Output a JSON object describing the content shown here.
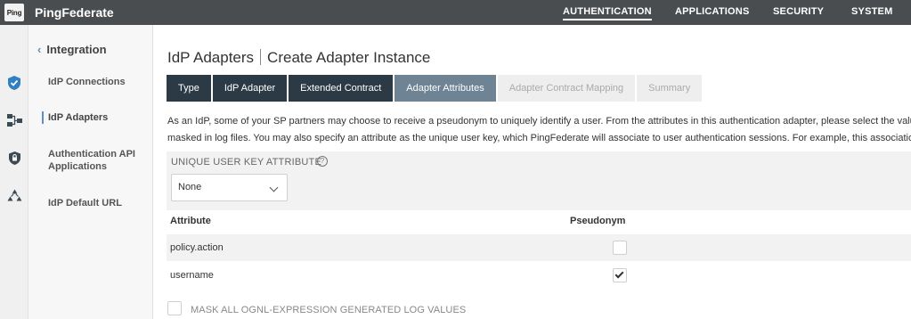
{
  "app": {
    "logo_text": "Ping",
    "brand": "PingFederate"
  },
  "topnav": [
    {
      "label": "AUTHENTICATION",
      "active": true
    },
    {
      "label": "APPLICATIONS",
      "active": false
    },
    {
      "label": "SECURITY",
      "active": false
    },
    {
      "label": "SYSTEM",
      "active": false
    }
  ],
  "rail_icons": [
    "shield-check-icon",
    "network-icon",
    "shield-lock-icon",
    "nodes-icon"
  ],
  "subnav": {
    "back_label": "Integration",
    "items": [
      {
        "label": "IdP Connections",
        "active": false
      },
      {
        "label": "IdP Adapters",
        "active": true
      },
      {
        "label": "Authentication API Applications",
        "active": false
      },
      {
        "label": "IdP Default URL",
        "active": false
      }
    ]
  },
  "page": {
    "title_section": "IdP Adapters",
    "title_page": "Create Adapter Instance",
    "steps": [
      {
        "label": "Type",
        "state": "done"
      },
      {
        "label": "IdP Adapter",
        "state": "done"
      },
      {
        "label": "Extended Contract",
        "state": "done"
      },
      {
        "label": "Adapter Attributes",
        "state": "current"
      },
      {
        "label": "Adapter Contract Mapping",
        "state": "todo"
      },
      {
        "label": "Summary",
        "state": "todo"
      }
    ],
    "description_line1": "As an IdP, some of your SP partners may choose to receive a pseudonym to uniquely identify a user. From the attributes in this authentication adapter, please select the values t",
    "description_line2": "masked in log files. You may also specify an attribute as the unique user key, which PingFederate will associate to user authentication sessions. For example, this association is",
    "unique_key": {
      "label": "UNIQUE USER KEY ATTRIBUTE",
      "help": "?",
      "selected": "None"
    },
    "table": {
      "headers": {
        "attribute": "Attribute",
        "pseudonym": "Pseudonym"
      },
      "rows": [
        {
          "attribute": "policy.action",
          "pseudonym": false
        },
        {
          "attribute": "username",
          "pseudonym": true
        }
      ]
    },
    "mask_all": {
      "label": "MASK ALL OGNL-EXPRESSION GENERATED LOG VALUES",
      "checked": false
    }
  },
  "colors": {
    "topbar": "#4a4d50",
    "step_done": "#2b3a44",
    "step_current": "#6e8393",
    "accent": "#5b8fc7"
  }
}
